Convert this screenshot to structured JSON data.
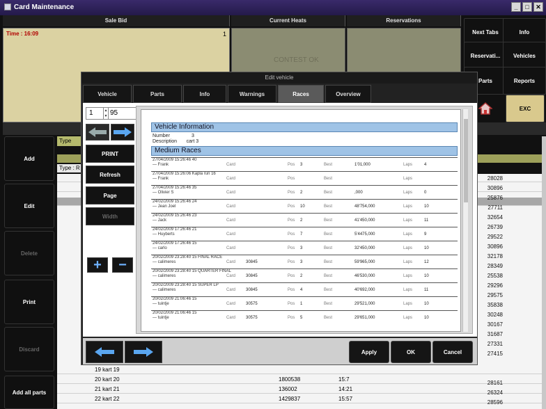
{
  "window": {
    "title": "Card Maintenance"
  },
  "top_headers": [
    "Sale Bid",
    "Current Heats",
    "Reservations"
  ],
  "sale_panel": {
    "time": "Time : 16:09",
    "number": "1"
  },
  "gray_panel_text": "CONTEST OK",
  "right_buttons": [
    "Next Tabs",
    "Info",
    "Reservati...",
    "Vehicles",
    "Parts",
    "Reports",
    "EXC"
  ],
  "left_buttons": [
    "Add",
    "Edit",
    "Delete",
    "Print",
    "Discard",
    "Add all parts"
  ],
  "type_label": "Type",
  "type_label2": "Type : R",
  "modal": {
    "title": "Edit vehicle",
    "tabs": [
      "Vehicle",
      "Parts",
      "Info",
      "Warnings",
      "Races",
      "Overview"
    ],
    "active_tab": "Races",
    "spinner_value1": "1",
    "spinner_value2": "95",
    "actions": [
      "PRINT",
      "Refresh",
      "Page",
      "Width"
    ],
    "footer_buttons": [
      "Apply",
      "OK",
      "Cancel"
    ]
  },
  "report": {
    "section1": "Vehicle Information",
    "info": [
      {
        "label": "Number",
        "value": "3"
      },
      {
        "label": "Description",
        "value": "cart 3"
      }
    ],
    "section2": "Medium Races",
    "races": [
      {
        "date": "27/04/2009 15:26:46",
        "heat": "40",
        "name": "Frank",
        "card": "",
        "pos": "3",
        "best": "1'01,000",
        "laps": "4"
      },
      {
        "date": "27/04/2009 15:26:06",
        "heat": "Kapla run 16",
        "name": "Frank",
        "card": "",
        "pos": "",
        "best": "",
        "laps": ""
      },
      {
        "date": "27/04/2009 15:26:46",
        "heat": "35",
        "name": "Olivier S",
        "card": "",
        "pos": "2",
        "best": ",000",
        "laps": "0"
      },
      {
        "date": "24/02/2009 15:26:46",
        "heat": "24",
        "name": "Jean Joel",
        "card": "",
        "pos": "10",
        "best": "48'754,000",
        "laps": "10"
      },
      {
        "date": "24/02/2009 15:26:46",
        "heat": "23",
        "name": "Jack",
        "card": "",
        "pos": "2",
        "best": "41'450,000",
        "laps": "11"
      },
      {
        "date": "24/02/2009 17:26:46",
        "heat": "21",
        "name": "Huyberts",
        "card": "",
        "pos": "7",
        "best": "5'4475,000",
        "laps": "9"
      },
      {
        "date": "24/02/2009 17:26:46",
        "heat": "15",
        "name": "carlo",
        "card": "",
        "pos": "3",
        "best": "32'450,000",
        "laps": "10"
      },
      {
        "date": "20/02/2009 23:28:40",
        "heat": "15 FINAL RACE",
        "name": "calimeres",
        "card": "30845",
        "pos": "3",
        "best": "59'965,000",
        "laps": "12"
      },
      {
        "date": "20/02/2009 23:28:40",
        "heat": "15 QUARTER FINAL",
        "name": "calimeres",
        "card": "30845",
        "pos": "2",
        "best": "46'530,000",
        "laps": "10"
      },
      {
        "date": "20/02/2009 23:28:40",
        "heat": "15 SUPER LP",
        "name": "calimeres",
        "card": "30845",
        "pos": "4",
        "best": "40'692,000",
        "laps": "11"
      },
      {
        "date": "20/02/2009 21:06:46",
        "heat": "15",
        "name": "tuintje",
        "card": "30575",
        "pos": "1",
        "best": "29'521,000",
        "laps": "10"
      },
      {
        "date": "20/02/2009 21:06:46",
        "heat": "15",
        "name": "tuintje",
        "card": "30575",
        "pos": "5",
        "best": "29'651,000",
        "laps": "10"
      }
    ],
    "labels": {
      "card": "Card",
      "pos": "Pos",
      "best": "Best",
      "laps": "Laps"
    }
  },
  "table_rows": [
    {
      "name": "19 kart 19",
      "c2": "",
      "c3": "",
      "c4": ""
    },
    {
      "name": "20 kart 20",
      "c2": "1800538",
      "c3": "15:7",
      "c4": ""
    },
    {
      "name": "21 kart 21",
      "c2": "136002",
      "c3": "14:21",
      "c4": ""
    },
    {
      "name": "22 kart 22",
      "c2": "1429837",
      "c3": "15:57",
      "c4": ""
    }
  ],
  "right_numbers": [
    "28028",
    "30896",
    "25876",
    "27711",
    "32654",
    "26739",
    "29522",
    "30896",
    "32178",
    "28349",
    "25538",
    "29296",
    "29575",
    "35838",
    "30248",
    "30167",
    "31687",
    "27331",
    "27415",
    "",
    "",
    "28161",
    "26324",
    "28596"
  ]
}
